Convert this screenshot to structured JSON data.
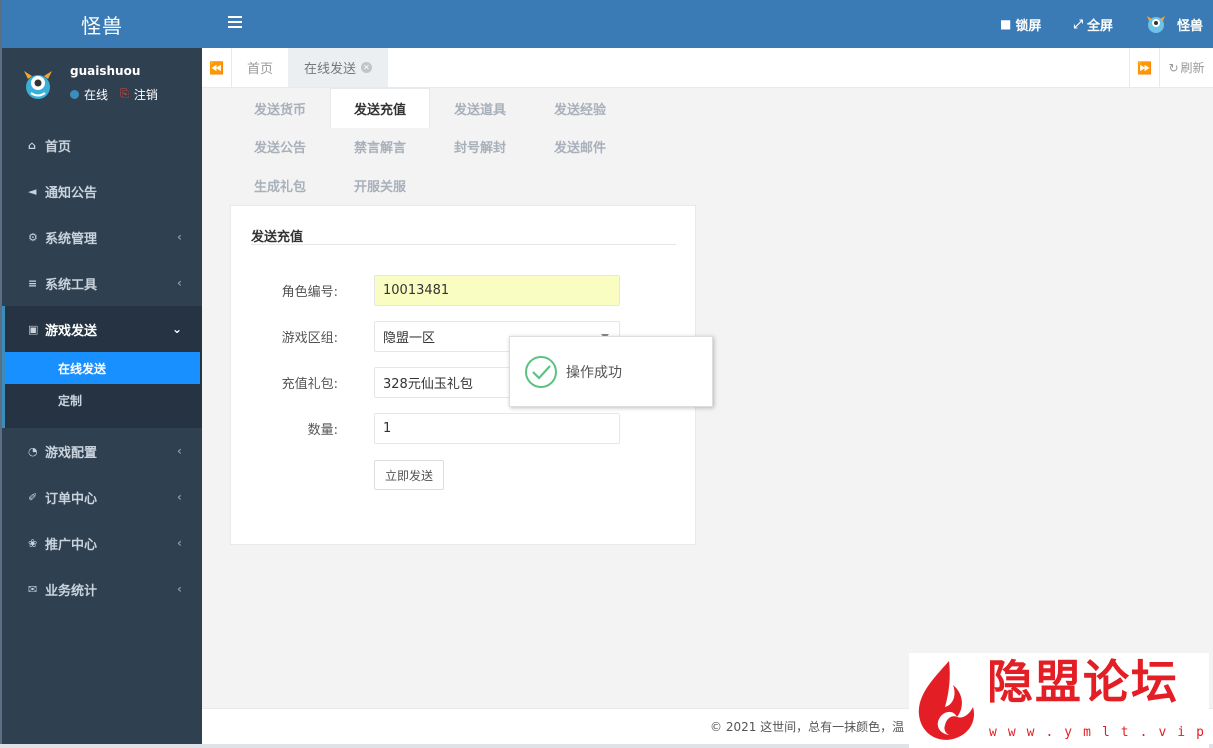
{
  "app": {
    "brand": "怪兽"
  },
  "user": {
    "name": "guaishuou",
    "status": "在线",
    "logout": "注销"
  },
  "header": {
    "lock": "锁屏",
    "fullscreen": "全屏",
    "username": "怪兽"
  },
  "sidebar": {
    "items": [
      {
        "label": "首页",
        "icon": "home-icon"
      },
      {
        "label": "通知公告",
        "icon": "bullhorn-icon"
      },
      {
        "label": "系统管理",
        "icon": "gear-icon"
      },
      {
        "label": "系统工具",
        "icon": "bars-icon"
      },
      {
        "label": "游戏发送",
        "icon": "gift-icon",
        "expanded": true,
        "children": [
          {
            "label": "在线发送",
            "active": true
          },
          {
            "label": "定制"
          }
        ]
      },
      {
        "label": "游戏配置",
        "icon": "dashboard-icon"
      },
      {
        "label": "订单中心",
        "icon": "brush-icon"
      },
      {
        "label": "推广中心",
        "icon": "handshake-icon"
      },
      {
        "label": "业务统计",
        "icon": "envelope-icon"
      }
    ]
  },
  "tabs": {
    "home": "首页",
    "active": "在线发送",
    "refresh": "刷新"
  },
  "subnav": [
    "发送货币",
    "发送充值",
    "发送道具",
    "发送经验",
    "发送公告",
    "禁言解言",
    "封号解封",
    "发送邮件",
    "生成礼包",
    "开服关服"
  ],
  "subnav_active": "发送充值",
  "form": {
    "title": "发送充值",
    "role_label": "角色编号:",
    "role_value": "10013481",
    "zone_label": "游戏区组:",
    "zone_value": "隐盟一区",
    "gift_label": "充值礼包:",
    "gift_value": "328元仙玉礼包",
    "qty_label": "数量:",
    "qty_value": "1",
    "submit": "立即发送"
  },
  "toast": {
    "text": "操作成功"
  },
  "footer": {
    "text": "© 2021 这世间，总有一抹颜色，温"
  },
  "watermark": {
    "title": "隐盟论坛",
    "url": "www.ymlt.vip"
  },
  "colors": {
    "header": "#3a7bb5",
    "sidebar": "#2f4050",
    "active_sub": "#1890ff",
    "watermark": "#e31e24"
  }
}
